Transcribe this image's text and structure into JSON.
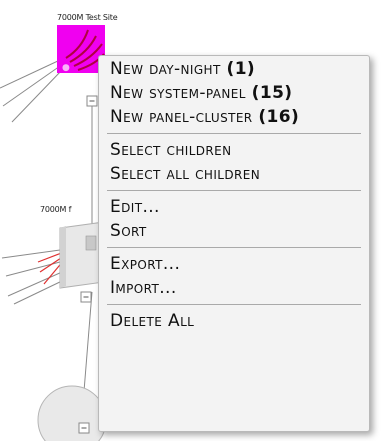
{
  "tree": {
    "site_label": "7000M Test Site",
    "second_label": "7000M f"
  },
  "colors": {
    "site_node": "#f000f0",
    "menu_bg": "#f3f3f3",
    "separator": "#a9a9a9"
  },
  "context_menu": {
    "new_day_night": {
      "label": "New day-night",
      "count": "(1)"
    },
    "new_system_panel": {
      "label": "New system-panel",
      "count": "(15)"
    },
    "new_panel_cluster": {
      "label": "New panel-cluster",
      "count": "(16)"
    },
    "select_children": "Select children",
    "select_all_children": "Select all children",
    "edit": "Edit...",
    "sort": "Sort",
    "export": "Export...",
    "import": "Import...",
    "delete_all": "Delete All"
  }
}
